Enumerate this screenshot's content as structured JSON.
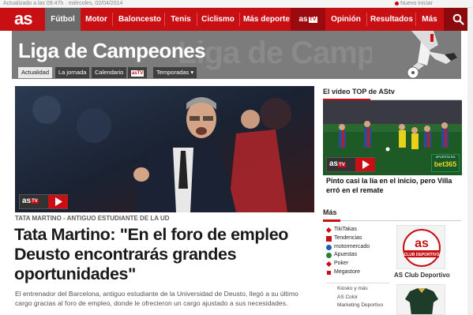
{
  "topbar": {
    "left_text": "Actualizado a las 09:47h · miércoles, 02/04/2014",
    "right_text": "Nuevo Iniciar"
  },
  "nav": {
    "logo": "as",
    "items": [
      {
        "label": "Fútbol",
        "active": true
      },
      {
        "label": "Motor"
      },
      {
        "label": "Baloncesto"
      },
      {
        "label": "Tenis"
      },
      {
        "label": "Ciclismo"
      },
      {
        "label": "Más deporte"
      },
      {
        "label": "as",
        "badge": "TV"
      },
      {
        "label": "Opinión"
      },
      {
        "label": "Resultados"
      },
      {
        "label": "Más"
      }
    ],
    "search_icon": "search-icon"
  },
  "section": {
    "title": "Liga de Campeones",
    "ghost_text": "Liga de Camp",
    "tabs": [
      {
        "label": "Actualidad",
        "current": true
      },
      {
        "label": "La jornada"
      },
      {
        "label": "Calendario"
      },
      {
        "label": "as",
        "badge": "TV"
      },
      {
        "label": "Temporadas ▾"
      }
    ]
  },
  "article": {
    "video_badge": "as",
    "video_badge_tv": "TV",
    "kicker": "TATA MARTINO - ANTIGUO ESTUDIANTE DE LA UD",
    "headline": "Tata Martino: \"En el foro de empleo Deusto encontrarás grandes oportunidades\"",
    "summary": "El entrenador del Barcelona, antiguo estudiante de la Universidad de Deusto, llegó a su último cargo gracias al foro de empleo, donde le ofrecieron un cargo ajustado a sus necesidades."
  },
  "sidebar": {
    "video_top_heading": "El vídeo TOP de AStv",
    "sponsor_top": "APUESTA EN",
    "sponsor": "bet365",
    "video_caption": "Pinto casi la lía en el inicio, pero Villa erró en el remate",
    "more_heading": "Más",
    "more_items": [
      {
        "label": "TikiTakas",
        "icon": "tikitakas-icon",
        "color": "#c80f14"
      },
      {
        "label": "Tendencias",
        "icon": "tendencias-icon",
        "color": "#c80f14"
      },
      {
        "label": "motormercado",
        "icon": "motormercado-icon",
        "color": "#1a5fb4"
      },
      {
        "label": "Apuestas",
        "icon": "apuestas-icon",
        "color": "#2e7d32"
      },
      {
        "label": "Poker",
        "icon": "poker-icon",
        "color": "#c80f14"
      },
      {
        "label": "Megastore",
        "icon": "megastore-icon",
        "color": "#c80f14"
      }
    ],
    "more_items_secondary": [
      "Kiosko y más",
      "AS Color",
      "Marketing Deportivo"
    ],
    "club_badge_top": "as",
    "club_badge_ribbon": "CLUB DEPORTIVO",
    "club_caption": "AS Club Deportivo"
  },
  "colors": {
    "brand_red": "#c80f14",
    "nav_active": "#6b6b6b",
    "banner_gray": "#7c7c7c"
  }
}
